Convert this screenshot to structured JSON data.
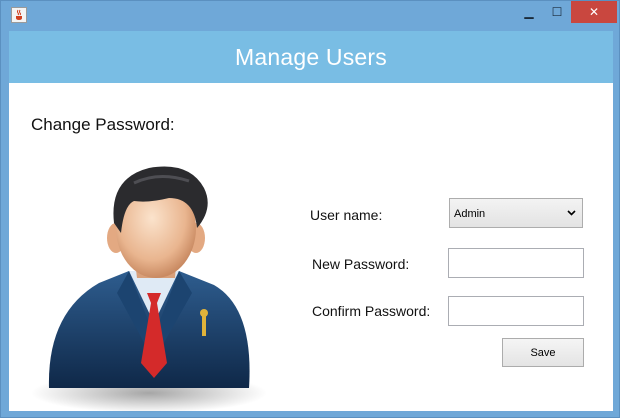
{
  "window": {
    "minimize_glyph": "▁",
    "maximize_glyph": "☐",
    "close_glyph": "✕"
  },
  "header": {
    "title": "Manage Users"
  },
  "section": {
    "title": "Change Password:"
  },
  "form": {
    "username_label": "User name:",
    "username_value": "Admin",
    "new_password_label": "New Password:",
    "new_password_value": "",
    "confirm_password_label": "Confirm Password:",
    "confirm_password_value": "",
    "save_label": "Save"
  },
  "icons": {
    "app": "java-cup-icon",
    "avatar": "businessman-avatar-icon",
    "dropdown": "chevron-down-icon"
  },
  "colors": {
    "banner": "#79bde4",
    "window_frame": "#6fa8d8",
    "close_button": "#c9473f"
  }
}
